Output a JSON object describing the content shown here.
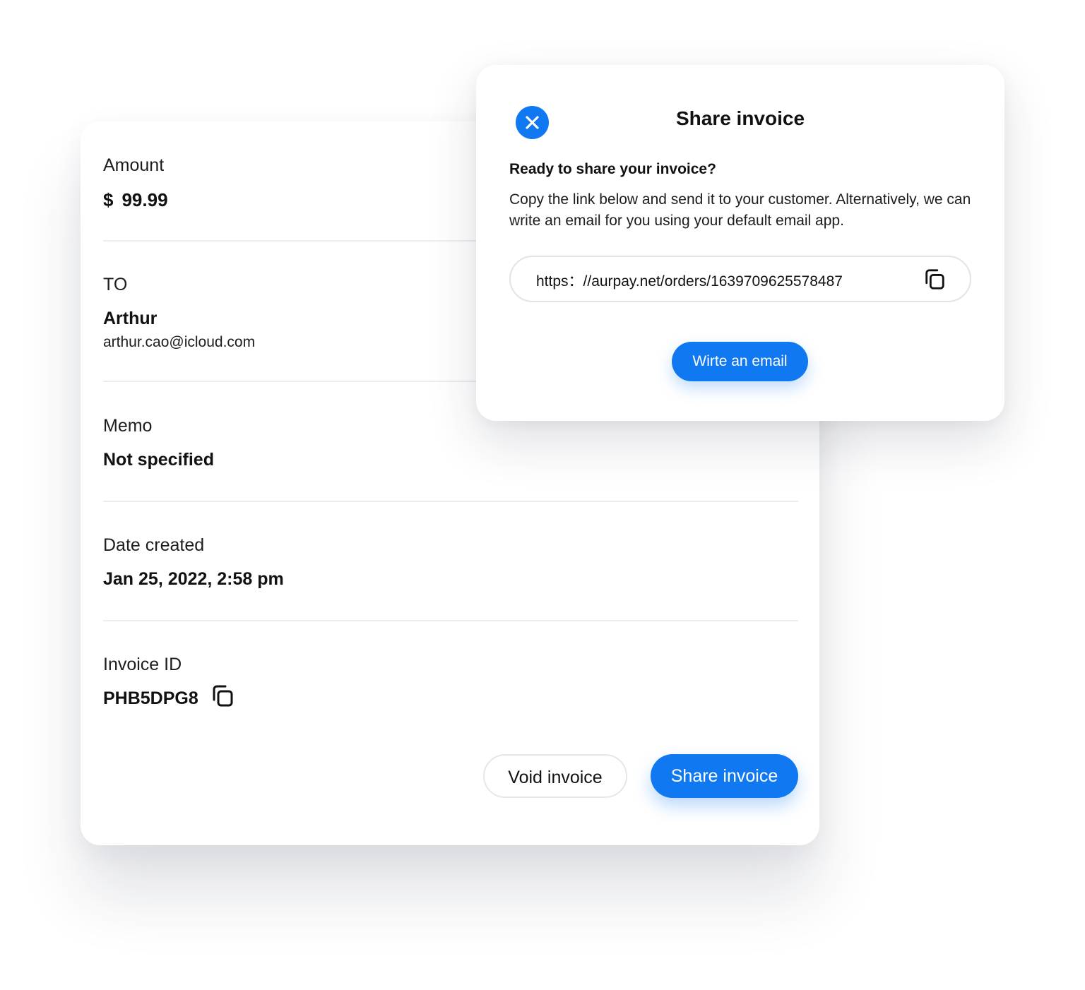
{
  "invoice": {
    "amount": {
      "label": "Amount",
      "currency": "$",
      "value": "99.99"
    },
    "to": {
      "label": "TO",
      "name": "Arthur",
      "email": "arthur.cao@icloud.com"
    },
    "memo": {
      "label": "Memo",
      "value": "Not specified"
    },
    "date_created": {
      "label": "Date created",
      "value": "Jan 25, 2022, 2:58 pm"
    },
    "invoice_id": {
      "label": "Invoice ID",
      "value": "PHB5DPG8",
      "copy_icon": "copy-icon"
    },
    "actions": {
      "void_label": "Void invoice",
      "share_label": "Share invoice"
    }
  },
  "share_dialog": {
    "title": "Share invoice",
    "close_icon": "close-icon",
    "heading": "Ready to share your invoice?",
    "body": "Copy the link below and send it to your customer. Alternatively, we can write an email for you using your default email app.",
    "link": "https：//aurpay.net/orders/1639709625578487",
    "copy_icon": "copy-icon",
    "email_button_label": "Wirte an email"
  },
  "colors": {
    "accent": "#1078f0",
    "text": "#111111",
    "divider": "#ececef"
  }
}
